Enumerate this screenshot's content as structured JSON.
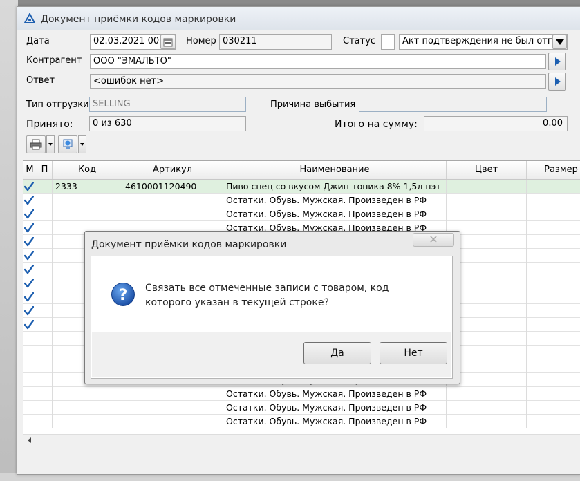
{
  "window": {
    "title": "Документ приёмки кодов маркировки"
  },
  "form": {
    "date_label": "Дата",
    "date_value": "02.03.2021 00",
    "number_label": "Номер",
    "number_value": "030211",
    "status_label": "Статус",
    "status_value": "Акт подтверждения не был отправ",
    "counterparty_label": "Контрагент",
    "counterparty_value": "ООО \"ЭМАЛЬТО\"",
    "answer_label": "Ответ",
    "answer_value": "<ошибок нет>",
    "shipment_type_label": "Тип отгрузки",
    "shipment_type_value": "SELLING",
    "withdrawal_reason_label": "Причина выбытия",
    "withdrawal_reason_value": "",
    "accepted_label": "Принято:",
    "accepted_value": "0 из 630",
    "total_label": "Итого на сумму:",
    "total_value": "0.00"
  },
  "grid": {
    "columns": [
      "М",
      "П",
      "Код",
      "Артикул",
      "Наименование",
      "Цвет",
      "Размер"
    ],
    "rows": [
      {
        "checked": true,
        "code": "2333",
        "article": "4610001120490",
        "name": "Пиво спец со вкусом Джин-тоника 8% 1,5л пэт"
      },
      {
        "checked": true,
        "code": "",
        "article": "",
        "name": "Остатки. Обувь. Мужская. Произведен в РФ"
      },
      {
        "checked": true,
        "code": "",
        "article": "",
        "name": "Остатки. Обувь. Мужская. Произведен в РФ"
      },
      {
        "checked": true,
        "code": "",
        "article": "",
        "name": "Остатки. Обувь. Мужская. Произведен в РФ"
      },
      {
        "checked": true,
        "code": "",
        "article": "",
        "name": "Остатки. Обувь. Мужская. Произведен в РФ"
      },
      {
        "checked": true,
        "code": "",
        "article": "",
        "name": "Остатки. Обувь. Мужская. Произведен в РФ"
      },
      {
        "checked": true,
        "code": "",
        "article": "",
        "name": "Остатки. Обувь. Мужская. Произведен в РФ"
      },
      {
        "checked": true,
        "code": "",
        "article": "",
        "name": "Остатки. Обувь. Мужская. Произведен в РФ"
      },
      {
        "checked": true,
        "code": "",
        "article": "",
        "name": "Остатки. Обувь. Мужская. Произведен в РФ"
      },
      {
        "checked": true,
        "code": "",
        "article": "",
        "name": "Остатки. Обувь. Мужская. Произведен в РФ"
      },
      {
        "checked": true,
        "code": "",
        "article": "",
        "name": "Остатки. Обувь. Мужская. Произведен в РФ"
      },
      {
        "checked": false,
        "code": "",
        "article": "",
        "name": "Остатки. Обувь. Мужская. Произведен в РФ"
      },
      {
        "checked": false,
        "code": "",
        "article": "",
        "name": "Остатки. Обувь. Мужская. Произведен в РФ"
      },
      {
        "checked": false,
        "code": "",
        "article": "",
        "name": "Остатки. Обувь. Мужская. Произведен в РФ"
      },
      {
        "checked": false,
        "code": "",
        "article": "",
        "name": "Остатки. Обувь. Мужская. Произведен в РФ"
      },
      {
        "checked": false,
        "code": "",
        "article": "",
        "name": "Остатки. Обувь. Мужская. Произведен в РФ"
      },
      {
        "checked": false,
        "code": "",
        "article": "",
        "name": "Остатки. Обувь. Мужская. Произведен в РФ"
      },
      {
        "checked": false,
        "code": "",
        "article": "",
        "name": "Остатки. Обувь. Мужская. Произведен в РФ"
      }
    ]
  },
  "dialog": {
    "title": "Документ приёмки кодов маркировки",
    "close_glyph": "✕",
    "message": "Связать все отмеченные записи с товаром, код которого указан в текущей строке?",
    "yes_label": "Да",
    "no_label": "Нет"
  },
  "colors": {
    "accent": "#1d5fb0",
    "selected_row": "#dff0df"
  }
}
